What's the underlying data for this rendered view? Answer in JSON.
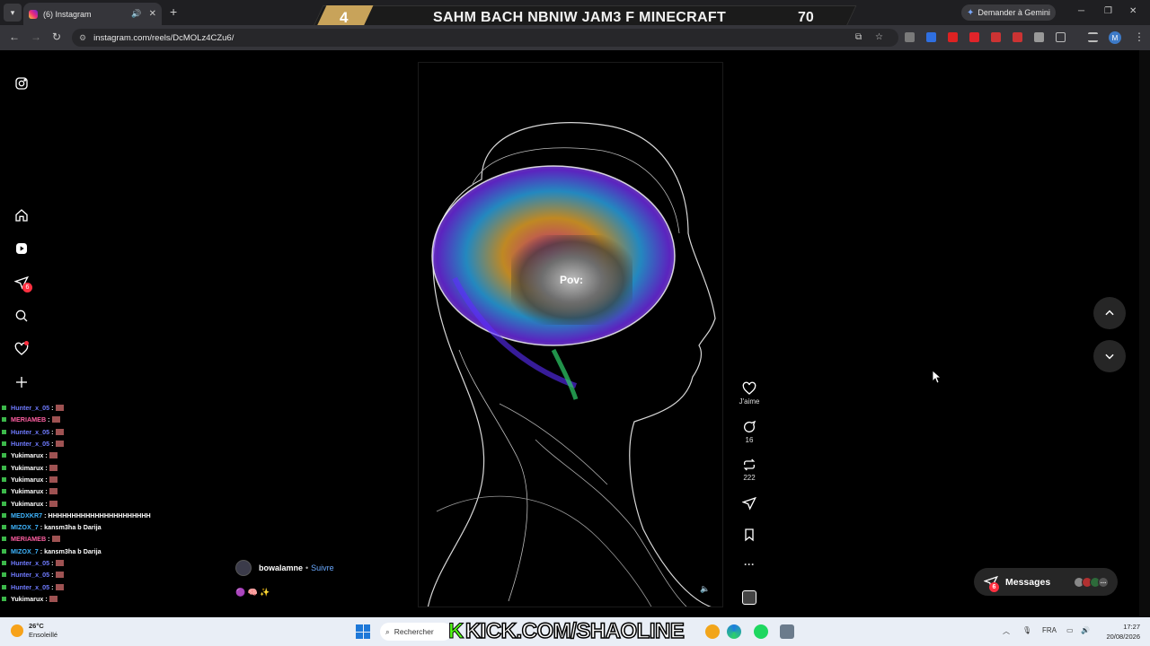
{
  "browser": {
    "tab_title": "(6) Instagram",
    "new_tab_icon": "plus-icon",
    "gemini_label": "Demander à Gemini",
    "url": "instagram.com/reels/DcMOLz4CZu6/"
  },
  "overlay": {
    "rank": "4",
    "title": "SAHM BACH NBNIW JAM3 F MINECRAFT",
    "score": "70",
    "kick_url": "KICK.COM/SHAOLINE"
  },
  "sidebar": {
    "icons": [
      "instagram-icon",
      "home-icon",
      "reels-icon",
      "messages-icon",
      "search-icon",
      "heart-icon",
      "plus-icon"
    ],
    "messages_badge": "6"
  },
  "chat": [
    {
      "user": "Hunter_x_05",
      "msg": ":",
      "color": "#6f7bff",
      "emote": true
    },
    {
      "user": "MERIAMEB",
      "msg": ":",
      "color": "#ff5fa2",
      "emote": true
    },
    {
      "user": "Hunter_x_05",
      "msg": ":",
      "color": "#6f7bff",
      "emote": true
    },
    {
      "user": "Hunter_x_05",
      "msg": ":",
      "color": "#6f7bff",
      "emote": true
    },
    {
      "user": "Yukimarux",
      "msg": ":",
      "color": "#ffffff",
      "emote": true
    },
    {
      "user": "Yukimarux",
      "msg": ":",
      "color": "#ffffff",
      "emote": true
    },
    {
      "user": "Yukimarux",
      "msg": ":",
      "color": "#ffffff",
      "emote": true
    },
    {
      "user": "Yukimarux",
      "msg": ":",
      "color": "#ffffff",
      "emote": true
    },
    {
      "user": "Yukimarux",
      "msg": ":",
      "color": "#ffffff",
      "emote": true
    },
    {
      "user": "MEDXKR7",
      "msg": ": HHHHHHHHHHHHHHHHHHHHHH",
      "color": "#3fb6ff",
      "emote": false
    },
    {
      "user": "MIZOX_7",
      "msg": ": kansm3ha b Darija",
      "color": "#3fb6ff",
      "emote": false
    },
    {
      "user": "MERIAMEB",
      "msg": ":",
      "color": "#ff5fa2",
      "emote": true
    },
    {
      "user": "MIZOX_7",
      "msg": ": kansm3ha b Darija",
      "color": "#3fb6ff",
      "emote": false
    },
    {
      "user": "Hunter_x_05",
      "msg": ":",
      "color": "#6f7bff",
      "emote": true
    },
    {
      "user": "Hunter_x_05",
      "msg": ":",
      "color": "#6f7bff",
      "emote": true
    },
    {
      "user": "Hunter_x_05",
      "msg": ":",
      "color": "#6f7bff",
      "emote": true
    },
    {
      "user": "Yukimarux",
      "msg": ":",
      "color": "#ffffff",
      "emote": true
    }
  ],
  "reel": {
    "caption_overlay": "Pov:",
    "author": "bowalamne",
    "follow_label": "Suivre",
    "separator": "•",
    "emojis": "🟣 🧠 ✨",
    "actions": {
      "like_label": "J'aime",
      "comments": "16",
      "reposts": "222"
    }
  },
  "messages_bar": {
    "label": "Messages",
    "badge": "6"
  },
  "taskbar": {
    "temperature": "26°C",
    "weather": "Ensoleillé",
    "search_placeholder": "Rechercher",
    "language": "FRA",
    "time": "17:27",
    "date": "20/08/2026"
  },
  "colors": {
    "accent_follow": "#6aa9ff",
    "badge": "#ff3040",
    "overlay_gold": "#c8a35a",
    "kick_green": "#53fc18"
  }
}
